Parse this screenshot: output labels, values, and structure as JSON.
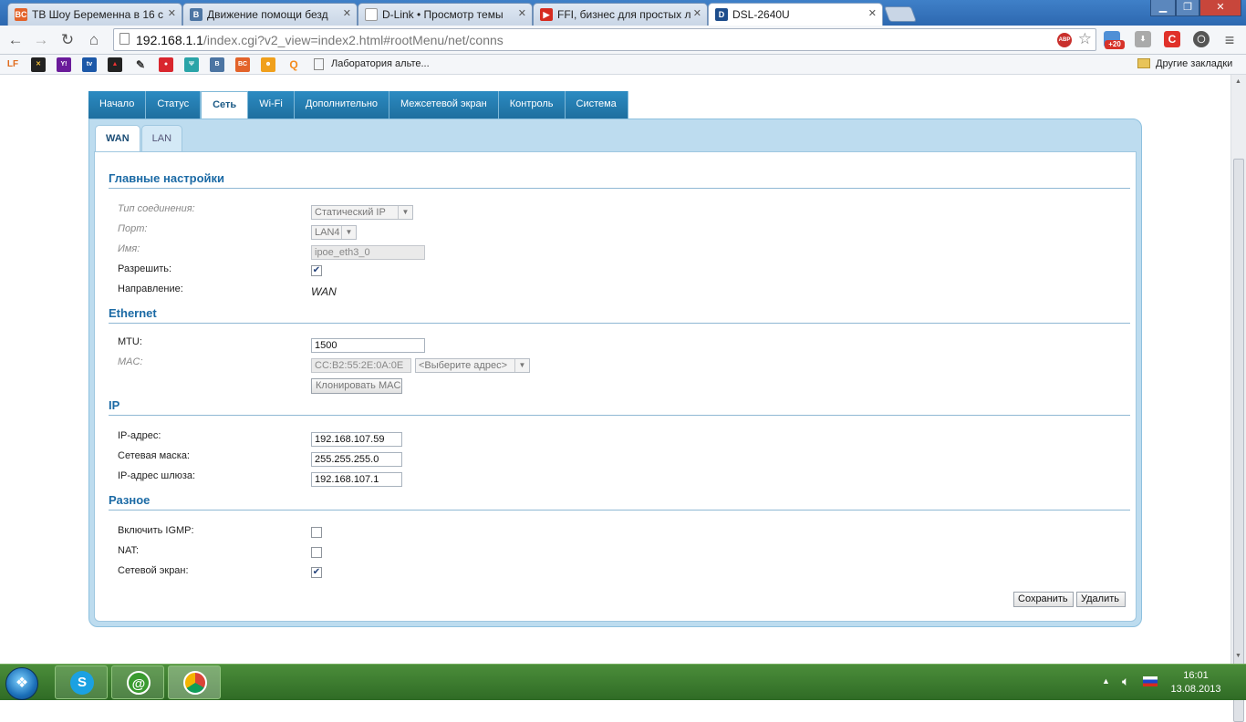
{
  "browser": {
    "tabs": [
      {
        "label": "ТВ Шоу Беременна в 16 с",
        "fav": "BC",
        "fav_color": "#e3632a"
      },
      {
        "label": "Движение помощи безд",
        "fav": "B",
        "fav_color": "#4c75a3"
      },
      {
        "label": "D-Link • Просмотр темы",
        "fav": "",
        "fav_color": "#ffffff"
      },
      {
        "label": "FFI, бизнес для простых л",
        "fav": "▶",
        "fav_color": "#d62b1f"
      },
      {
        "label": "DSL-2640U",
        "fav": "D",
        "fav_color": "#1d4d8c"
      }
    ],
    "url_host": "192.168.1.1",
    "url_path": "/index.cgi?v2_view=index2.html#rootMenu/net/conns",
    "ext_badge": "+20",
    "bookmarks": {
      "folder_label": "Лаборатория альте...",
      "other_label": "Другие закладки"
    }
  },
  "router": {
    "menu": [
      "Начало",
      "Статус",
      "Сеть",
      "Wi-Fi",
      "Дополнительно",
      "Межсетевой экран",
      "Контроль",
      "Система"
    ],
    "menu_active": "Сеть",
    "subtabs": [
      "WAN",
      "LAN"
    ],
    "sections": {
      "main": "Главные настройки",
      "ethernet": "Ethernet",
      "ip": "IP",
      "misc": "Разное"
    },
    "main": {
      "conn_type_label": "Тип соединения:",
      "conn_type_value": "Статический IP",
      "port_label": "Порт:",
      "port_value": "LAN4",
      "name_label": "Имя:",
      "name_value": "ipoe_eth3_0",
      "enable_label": "Разрешить:",
      "direction_label": "Направление:",
      "direction_value": "WAN"
    },
    "ethernet": {
      "mtu_label": "MTU:",
      "mtu_value": "1500",
      "mac_label": "MAC:",
      "mac_value": "CC:B2:55:2E:0A:0E",
      "mac_select": "<Выберите адрес>",
      "clone_button": "Клонировать MAC"
    },
    "ip": {
      "ip_label": "IP-адрес:",
      "ip_value": "192.168.107.59",
      "mask_label": "Сетевая маска:",
      "mask_value": "255.255.255.0",
      "gw_label": "IP-адрес шлюза:",
      "gw_value": "192.168.107.1"
    },
    "misc": {
      "igmp_label": "Включить IGMP:",
      "nat_label": "NAT:",
      "firewall_label": "Сетевой экран:"
    },
    "checks": {
      "enable": true,
      "igmp": false,
      "nat": false,
      "firewall": true
    },
    "buttons": {
      "save": "Сохранить",
      "delete": "Удалить"
    }
  },
  "taskbar": {
    "time": "16:01",
    "date": "13.08.2013"
  }
}
